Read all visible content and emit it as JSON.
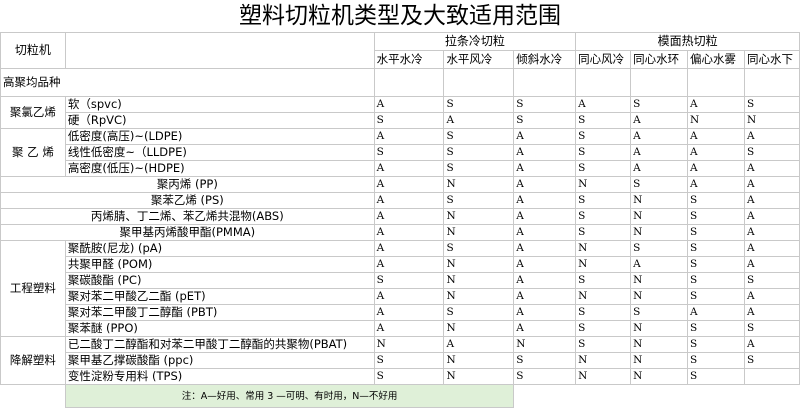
{
  "title": "塑料切粒机类型及大致适用范围",
  "header": {
    "machine_label": "切粒机",
    "group1": "拉条冷切粒",
    "group2": "模面热切粒",
    "columns": [
      "水平水冷",
      "水平风冷",
      "倾斜水冷",
      "同心风冷",
      "同心水环",
      "偏心水雾",
      "同心水下"
    ],
    "polymer_label": "高聚均品种"
  },
  "groups": [
    {
      "name": "聚氯乙烯",
      "rows": [
        {
          "label": "软（spvc)",
          "values": [
            "A",
            "S",
            "S",
            "A",
            "S",
            "A",
            "S"
          ]
        },
        {
          "label": "硬（RpVC)",
          "values": [
            "S",
            "A",
            "S",
            "S",
            "A",
            "N",
            "N"
          ]
        }
      ]
    },
    {
      "name": "聚 乙 烯",
      "rows": [
        {
          "label": "低密度(高压)~(LDPE)",
          "values": [
            "A",
            "S",
            "A",
            "S",
            "A",
            "A",
            "A"
          ]
        },
        {
          "label": "线性低密度~（LLDPE)",
          "values": [
            "S",
            "S",
            "A",
            "S",
            "A",
            "A",
            "S"
          ]
        },
        {
          "label": "高密度(低压)~(HDPE)",
          "values": [
            "A",
            "S",
            "A",
            "S",
            "A",
            "A",
            "A"
          ]
        }
      ]
    },
    {
      "name": "",
      "rows": [
        {
          "label": "聚丙烯 (PP)",
          "values": [
            "A",
            "N",
            "A",
            "N",
            "S",
            "A",
            "A"
          ]
        },
        {
          "label": "聚苯乙烯 (PS)",
          "values": [
            "A",
            "S",
            "A",
            "S",
            "N",
            "S",
            "A"
          ]
        },
        {
          "label": "丙烯腈、丁二烯、苯乙烯共混物(ABS)",
          "values": [
            "A",
            "N",
            "A",
            "S",
            "N",
            "S",
            "A"
          ]
        },
        {
          "label": "聚甲基丙烯酸甲酯(PMMA)",
          "values": [
            "A",
            "N",
            "A",
            "S",
            "N",
            "S",
            "A"
          ]
        }
      ]
    },
    {
      "name": "工程塑料",
      "rows": [
        {
          "label": "聚酰胺(尼龙) (pA)",
          "values": [
            "A",
            "S",
            "A",
            "N",
            "S",
            "S",
            "A"
          ]
        },
        {
          "label": "共聚甲醛 (POM)",
          "values": [
            "A",
            "N",
            "A",
            "N",
            "A",
            "S",
            "A"
          ]
        },
        {
          "label": "聚碳酸酯 (PC)",
          "values": [
            "S",
            "N",
            "A",
            "S",
            "N",
            "S",
            "S"
          ]
        },
        {
          "label": "聚对苯二甲酸乙二酯 (pET)",
          "values": [
            "A",
            "N",
            "A",
            "N",
            "N",
            "S",
            "A"
          ]
        },
        {
          "label": "聚对苯二甲酸丁二醇酯 (PBT)",
          "values": [
            "A",
            "S",
            "A",
            "S",
            "S",
            "A",
            "A"
          ]
        },
        {
          "label": "聚苯醚 (PPO)",
          "values": [
            "A",
            "N",
            "A",
            "S",
            "N",
            "S",
            "S"
          ]
        }
      ]
    },
    {
      "name": "降解塑料",
      "rows": [
        {
          "label": "已二酸丁二醇酯和对苯二甲酸丁二醇酯的共聚物(PBAT)",
          "values": [
            "N",
            "A",
            "N",
            "S",
            "N",
            "S",
            "A"
          ]
        },
        {
          "label": "聚甲基乙撑碳酸酯 (ppc)",
          "values": [
            "S",
            "N",
            "S",
            "N",
            "N",
            "S",
            "S"
          ]
        },
        {
          "label": "变性淀粉专用料 (TPS)",
          "values": [
            "S",
            "N",
            "S",
            "N",
            "N",
            "S",
            ""
          ]
        }
      ]
    }
  ],
  "note": "注：A—好用、常用 3 —可明、有时用，N—不好用",
  "colors": {
    "note_bg": "#dff0d8",
    "grid": "#c9c9c9"
  }
}
